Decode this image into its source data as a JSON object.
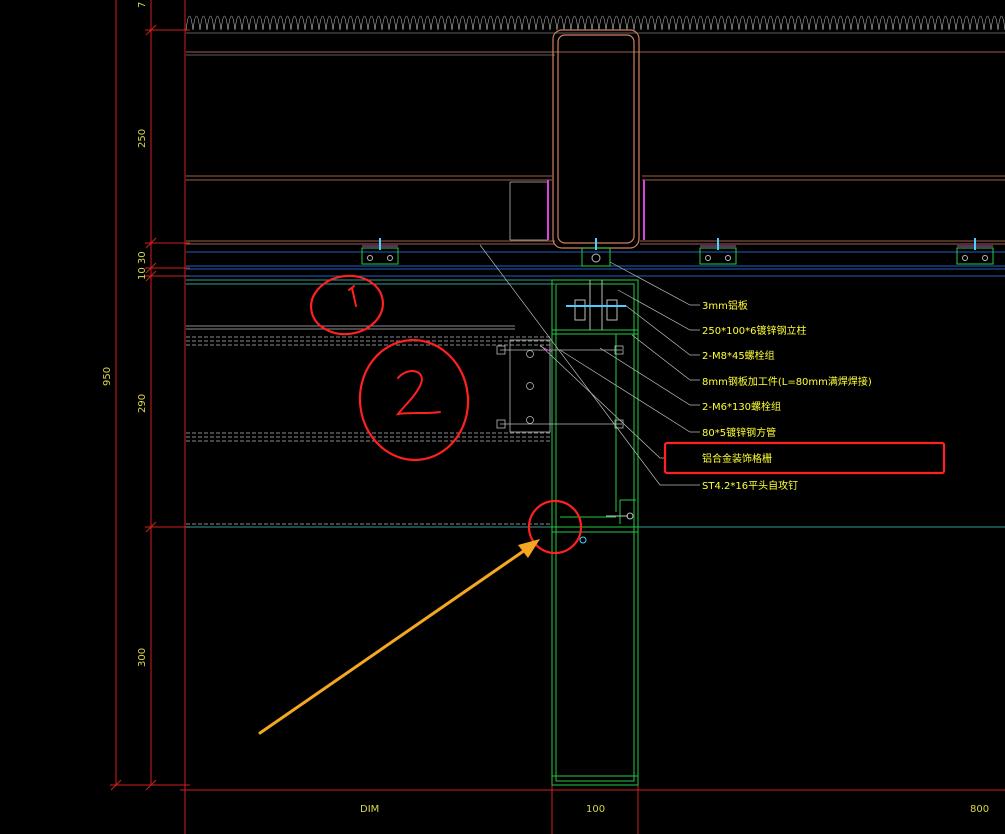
{
  "drawing": {
    "dimensions_vertical": [
      {
        "id": "dim-7",
        "label": "7"
      },
      {
        "id": "dim-250",
        "label": "250"
      },
      {
        "id": "dim-10-30",
        "label": "10 30"
      },
      {
        "id": "dim-290",
        "label": "290"
      },
      {
        "id": "dim-300",
        "label": "300"
      },
      {
        "id": "dim-950",
        "label": "950"
      }
    ],
    "dimensions_horizontal": [
      {
        "id": "dim-dim",
        "label": "DIM"
      },
      {
        "id": "dim-100",
        "label": "100"
      },
      {
        "id": "dim-800",
        "label": "800"
      }
    ],
    "notes": [
      "3mm铝板",
      "250*100*6镀锌钢立柱",
      "2-M8*45螺栓组",
      "8mm钢板加工件(L=80mm满焊焊接)",
      "2-M6*130螺栓组",
      "80*5镀锌钢方管",
      "铝合金装饰格栅",
      "ST4.2*16平头自攻钉"
    ],
    "highlighted_note_index": 6,
    "handwritten_marks": [
      "1",
      "2"
    ],
    "colors": {
      "background": "#000000",
      "dimension": "#d02020",
      "note_text": "#ffff33",
      "aluminum": "#22cc44",
      "steel": "#d08060",
      "annotation_red": "#ff2020",
      "arrow": "#f5a623"
    }
  }
}
